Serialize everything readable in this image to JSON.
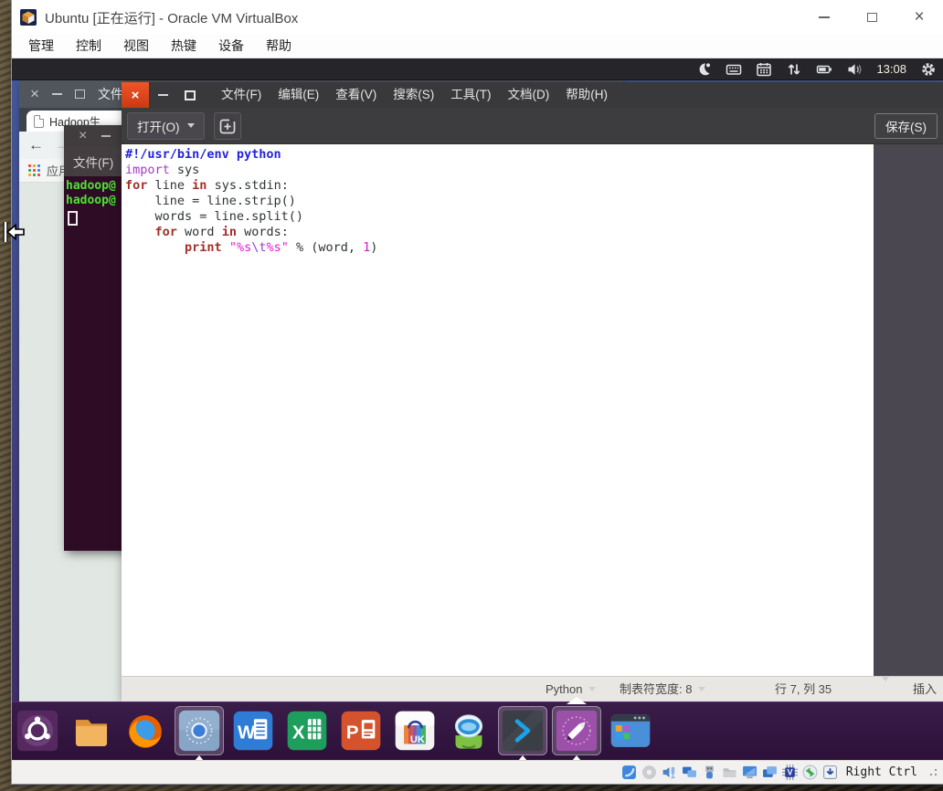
{
  "host_window": {
    "title": "Ubuntu [正在运行] - Oracle VM VirtualBox",
    "controls": {
      "minimize": "─",
      "maximize": "□",
      "close": "×"
    },
    "menus": [
      "管理",
      "控制",
      "视图",
      "热键",
      "设备",
      "帮助"
    ],
    "status_icons": [
      "hdd-icon",
      "optical-disc-icon",
      "audio-icon",
      "network-adapters-icon",
      "usb-icon",
      "shared-folders-icon",
      "display-icon",
      "virtual-screens-icon",
      "cpu-features-icon",
      "mouse-integration-icon",
      "keyboard-capture-icon"
    ],
    "host_key": "Right Ctrl"
  },
  "guest": {
    "panel": {
      "icons": [
        "weather-icon",
        "keyboard-layout-icon",
        "calendar-icon",
        "network-traffic-icon",
        "battery-icon",
        "volume-icon"
      ],
      "time": "13:08",
      "session_icon": "session-gear-icon"
    },
    "browser": {
      "close": "×",
      "menu_hint": "文件(F)",
      "tab_title": "Hadoop生",
      "back": "←",
      "forward": "→",
      "apps_label": "应用"
    },
    "terminal": {
      "close": "×",
      "menu_file": "文件(F)",
      "prompts": [
        "hadoop@",
        "hadoop@"
      ]
    },
    "editor": {
      "close": "×",
      "menus": [
        "文件(F)",
        "编辑(E)",
        "查看(V)",
        "搜索(S)",
        "工具(T)",
        "文档(D)",
        "帮助(H)"
      ],
      "open_button": "打开(O)",
      "save_button": "保存(S)",
      "code": [
        [
          {
            "t": "#!/usr/bin/env python",
            "c": "sh"
          }
        ],
        [
          {
            "t": "import",
            "c": "im"
          },
          {
            "t": " sys",
            "c": "pl"
          }
        ],
        [
          {
            "t": "for",
            "c": "kw"
          },
          {
            "t": " line ",
            "c": "pl"
          },
          {
            "t": "in",
            "c": "kw"
          },
          {
            "t": " sys.stdin:",
            "c": "pl"
          }
        ],
        [
          {
            "t": "    line = line.strip()",
            "c": "pl"
          }
        ],
        [
          {
            "t": "    words = line.split()",
            "c": "pl"
          }
        ],
        [
          {
            "t": "    ",
            "c": "pl"
          },
          {
            "t": "for",
            "c": "kw"
          },
          {
            "t": " word ",
            "c": "pl"
          },
          {
            "t": "in",
            "c": "kw"
          },
          {
            "t": " words:",
            "c": "pl"
          }
        ],
        [
          {
            "t": "        ",
            "c": "pl"
          },
          {
            "t": "print",
            "c": "kw"
          },
          {
            "t": " ",
            "c": "pl"
          },
          {
            "t": "\"%s",
            "c": "st"
          },
          {
            "t": "\\t",
            "c": "es"
          },
          {
            "t": "%s\"",
            "c": "st"
          },
          {
            "t": " % (word, ",
            "c": "pl"
          },
          {
            "t": "1",
            "c": "nu"
          },
          {
            "t": ")",
            "c": "pl"
          }
        ]
      ],
      "status": {
        "language": "Python",
        "tab_width": "制表符宽度: 8",
        "cursor_position": "行 7, 列 35",
        "mode": "插入"
      }
    },
    "dock": {
      "items": [
        {
          "name": "ubuntu-launcher"
        },
        {
          "name": "file-manager"
        },
        {
          "name": "firefox"
        },
        {
          "name": "screenshot-tool",
          "active": true
        },
        {
          "name": "word"
        },
        {
          "name": "excel"
        },
        {
          "name": "powerpoint"
        },
        {
          "name": "software-center"
        },
        {
          "name": "kylin-assistant"
        },
        {
          "name": "terminal",
          "active": true
        },
        {
          "name": "text-editor",
          "active": true,
          "focused": true
        },
        {
          "name": "workspace-switcher"
        }
      ]
    }
  }
}
